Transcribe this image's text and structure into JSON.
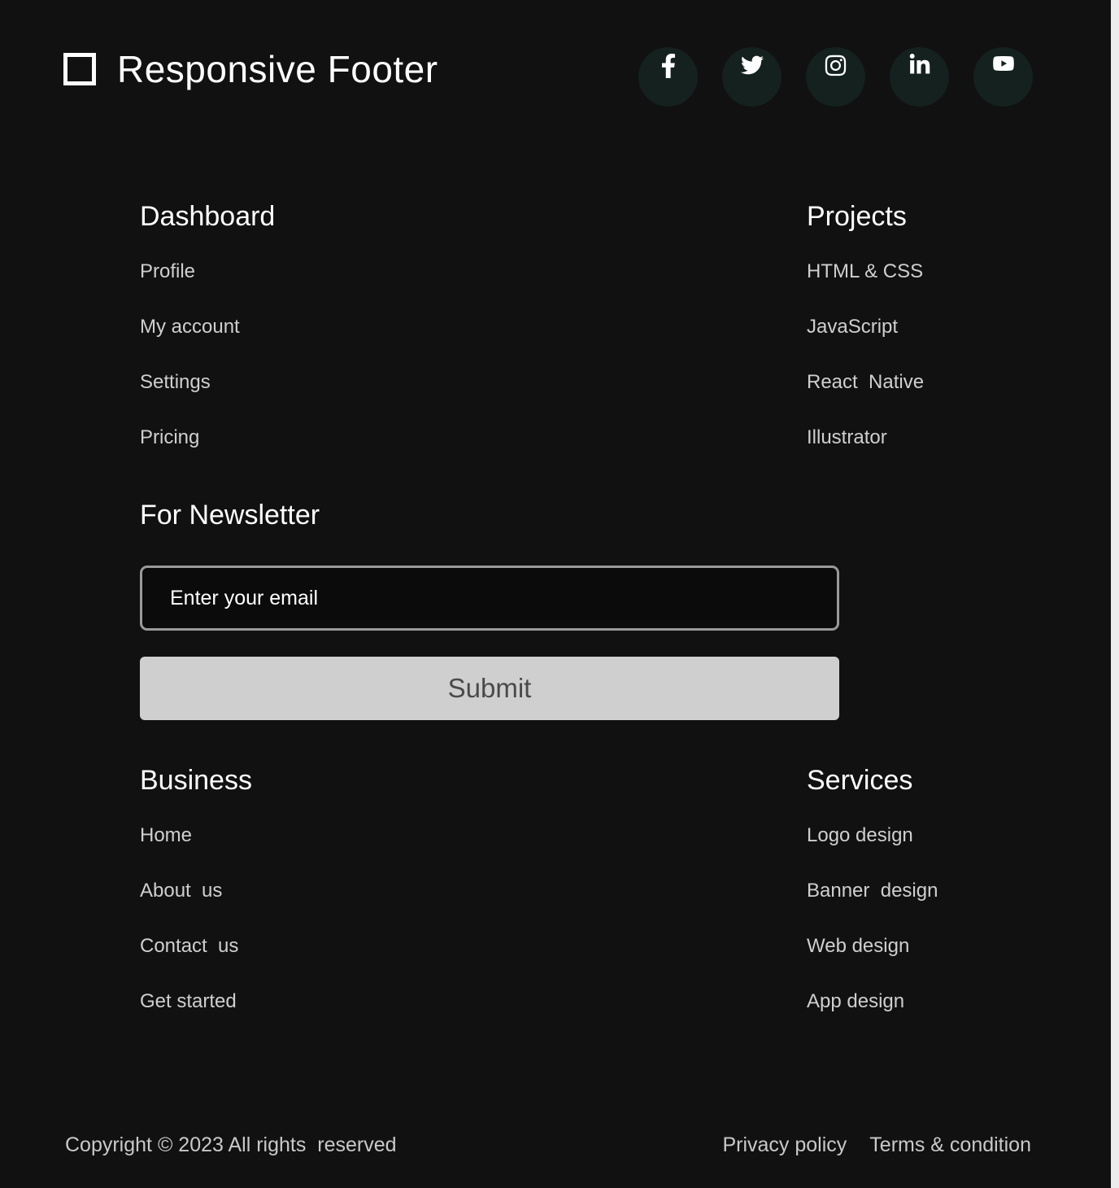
{
  "colors": {
    "background": "#111111",
    "social_circle": "#14211f",
    "heading_text": "#ffffff",
    "link_text": "#cfcfcf",
    "submit_bg": "#cfcfcf",
    "submit_text": "#4a4a4a",
    "input_border": "#9a9a9a",
    "page_edge": "#ececec"
  },
  "header": {
    "logo_icon": "square-outline-icon",
    "title": "Responsive  Footer",
    "socials": [
      {
        "name": "facebook",
        "icon": "facebook-icon"
      },
      {
        "name": "twitter",
        "icon": "twitter-icon"
      },
      {
        "name": "instagram",
        "icon": "instagram-icon"
      },
      {
        "name": "linkedin",
        "icon": "linkedin-icon"
      },
      {
        "name": "youtube",
        "icon": "youtube-icon"
      }
    ]
  },
  "columns": {
    "dashboard": {
      "heading": "Dashboard",
      "links": [
        "Profile",
        "My account",
        "Settings",
        "Pricing"
      ]
    },
    "projects": {
      "heading": "Projects",
      "links": [
        "HTML & CSS",
        "JavaScript",
        "React  Native",
        "Illustrator"
      ]
    },
    "business": {
      "heading": "Business",
      "links": [
        "Home",
        "About  us",
        "Contact  us",
        "Get started"
      ]
    },
    "services": {
      "heading": "Services",
      "links": [
        "Logo design",
        "Banner  design",
        "Web design",
        "App design"
      ]
    }
  },
  "newsletter": {
    "heading": "For Newsletter",
    "email_placeholder": "Enter your email",
    "email_value": "",
    "submit_label": "Submit"
  },
  "bottom": {
    "copyright": "Copyright © 2023 All rights  reserved",
    "legal": [
      {
        "label": "Privacy policy"
      },
      {
        "label": "Terms & condition"
      }
    ]
  }
}
